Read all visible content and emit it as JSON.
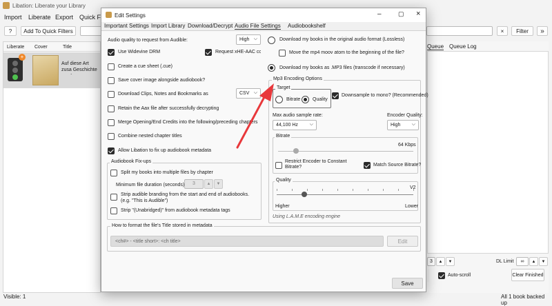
{
  "main": {
    "title": "Libation: Liberate your Library",
    "menu": [
      "Import",
      "Liberate",
      "Export",
      "Quick Filte"
    ],
    "help_label": "?",
    "add_quick_filters_label": "Add To Quick Filters",
    "clear_filter_label": "×",
    "filter_label": "Filter",
    "columns": {
      "liberate": "Liberate",
      "cover": "Cover",
      "title": "Title"
    },
    "row_title": "Auf diese Art zusa Geschichte von L",
    "queue_tabs": {
      "queue": "Queue",
      "queue_log": "Queue Log"
    },
    "queue_count": "3",
    "dl_limit_label": "DL Limit",
    "dl_limit_value": "∞",
    "auto_scroll_label": "Auto-scroll",
    "clear_finished_label": "Clear Finished",
    "status_visible": "Visible: 1",
    "status_backup": "All 1 book backed up"
  },
  "dialog": {
    "title": "Edit Settings",
    "tabs": [
      "Important Settings",
      "Import Library",
      "Download/Decrypt",
      "Audio File Settings",
      "Audiobookshelf"
    ],
    "quality_label": "Audio quality to request from Audible:",
    "quality_value": "High",
    "widevine_label": "Use Widevine DRM",
    "xhe_label": "Request xHE-AAC codec",
    "cue_label": "Create a cue sheet (.cue)",
    "cover_label": "Save cover image alongside audiobook?",
    "clips_label": "Download Clips, Notes and Bookmarks as",
    "clips_format": "CSV",
    "retain_aax_label": "Retain the Aax file after successfully decrypting",
    "merge_credits_label": "Merge Opening/End Credits into the following/preceding chapters",
    "combine_chapters_label": "Combine nested chapter titles",
    "fix_metadata_label": "Allow Libation to fix up audiobook metadata",
    "fixups_group": "Audiobook Fix-ups",
    "split_label": "Split my books into multiple files by chapter",
    "min_duration_label": "Minimum file duration (seconds)",
    "min_duration_value": "3",
    "strip_branding_label": "Strip audible branding from the start and end of audiobooks.",
    "strip_branding_sub": "(e.g. \"This is Audible\")",
    "strip_unabridged_label": "Strip \"(Unabridged)\" from audiobook metadata tags",
    "original_format_label": "Download my books in the original audio format (Lossless)",
    "moov_label": "Move the mp4 moov atom to the beginning of the file?",
    "mp3_label": "Download my books as .MP3 files (transcode if necessary)",
    "mp3_group": "Mp3 Encoding Options",
    "target_group": "Target",
    "target_bitrate": "Bitrate",
    "target_quality": "Quality",
    "downsample_label": "Downsample to mono? (Recommended)",
    "sample_rate_label": "Max audio sample rate:",
    "sample_rate_value": "44,100 Hz",
    "encoder_quality_label": "Encoder Quality:",
    "encoder_quality_value": "High",
    "bitrate_group": "Bitrate",
    "bitrate_value": "64 Kbps",
    "restrict_label": "Restrict Encoder to Constant Bitrate?",
    "match_source_label": "Match Source Bitrate?",
    "quality_group": "Quality",
    "quality_scale": "V2",
    "quality_higher": "Higher",
    "quality_lower": "Lower",
    "lame_label": "Using L.A.M.E encoding engine",
    "title_format_group": "How to format the file's Title stored in metadata",
    "title_format_value": "<ch#> - <title short>: <ch title>",
    "edit_label": "Edit",
    "save_label": "Save",
    "quality_slider_level": 0.2
  },
  "colors": {
    "annotation_arrow": "#e8383b"
  }
}
